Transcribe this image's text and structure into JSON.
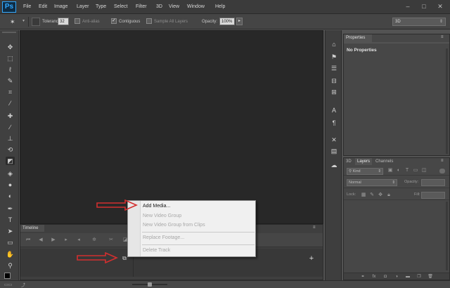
{
  "app": {
    "logo_text": "Ps",
    "menus": [
      "File",
      "Edit",
      "Image",
      "Layer",
      "Type",
      "Select",
      "Filter",
      "3D",
      "View",
      "Window",
      "Help"
    ],
    "window_controls": [
      "–",
      "□",
      "✕"
    ]
  },
  "options_bar": {
    "tolerance_label": "Tolerance:",
    "tolerance_value": "32",
    "anti_alias_label": "Anti-alias",
    "anti_alias_checked": false,
    "contiguous_label": "Contiguous",
    "contiguous_checked": true,
    "sample_all_layers_label": "Sample All Layers",
    "sample_all_layers_checked": false,
    "opacity_label": "Opacity:",
    "opacity_value": "100%",
    "workspace_select": "3D"
  },
  "tools": [
    "move-tool-icon",
    "marquee-tool-icon",
    "lasso-tool-icon",
    "quick-select-tool-icon",
    "crop-tool-icon",
    "eyedropper-tool-icon",
    "healing-brush-tool-icon",
    "brush-tool-icon",
    "clone-stamp-tool-icon",
    "history-brush-tool-icon",
    "eraser-tool-icon",
    "paint-bucket-tool-icon",
    "blur-tool-icon",
    "dodge-tool-icon",
    "pen-tool-icon",
    "type-tool-icon",
    "path-selection-tool-icon",
    "rectangle-tool-icon",
    "hand-tool-icon",
    "zoom-tool-icon",
    "color-swatches-icon"
  ],
  "timeline": {
    "tab_label": "Timeline",
    "add_track_symbol": "+"
  },
  "context_menu": {
    "items": [
      {
        "label": "Add Media...",
        "enabled": true
      },
      {
        "label": "New Video Group",
        "enabled": false
      },
      {
        "label": "New Video Group from Clips",
        "enabled": false
      },
      {
        "label": "Replace Footage...",
        "enabled": false
      },
      {
        "label": "Delete Track",
        "enabled": false
      }
    ]
  },
  "properties_panel": {
    "tab_label": "Properties",
    "message": "No Properties"
  },
  "layers_panel": {
    "tabs": [
      "3D",
      "Layers",
      "Channels"
    ],
    "active_tab": "Layers",
    "filter_kind": "Kind",
    "blend_mode": "Normal",
    "opacity_label": "Opacity:",
    "lock_label": "Lock:",
    "fill_label": "Fill:"
  },
  "annotations": {
    "arrow_color": "#d32f2f"
  }
}
